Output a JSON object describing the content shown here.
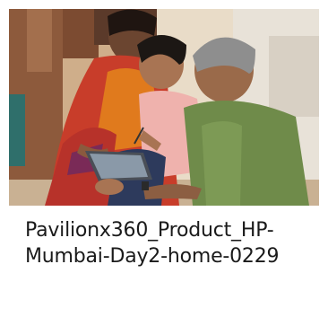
{
  "card": {
    "image": {
      "subject": "photo-family-using-laptop-tablet"
    },
    "title_lines": [
      "Pavilionx360_Product_HP-",
      "Mumbai-Day2-home-0229"
    ]
  }
}
